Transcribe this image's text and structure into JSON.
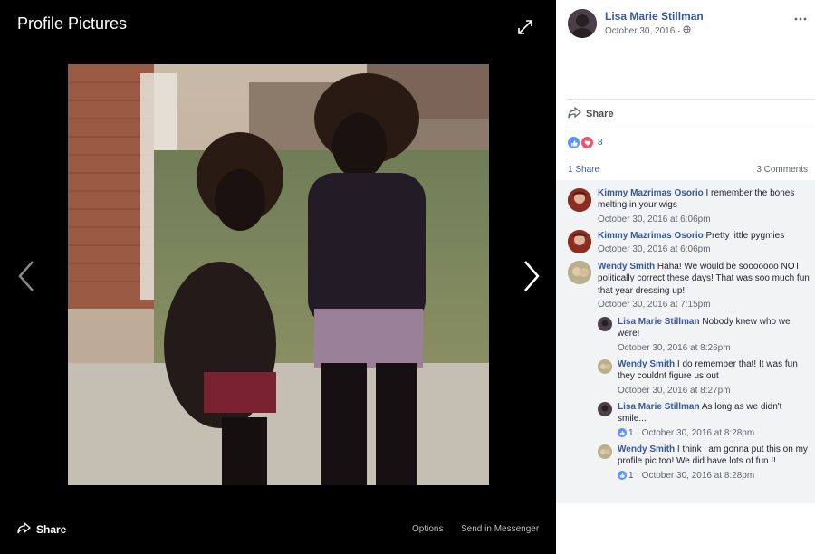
{
  "viewer": {
    "title": "Profile Pictures",
    "share_label": "Share",
    "options_label": "Options",
    "send_label": "Send in Messenger"
  },
  "post": {
    "author": "Lisa Marie Stillman",
    "date": "October 30, 2016 ·",
    "share_label": "Share",
    "reaction_count": "8",
    "shares_label": "1 Share",
    "comments_label": "3 Comments"
  },
  "comments": [
    {
      "name": "Kimmy Mazrimas Osorio",
      "text": " I remember the bones melting in your wigs",
      "time": "October 30, 2016 at 6:06pm"
    },
    {
      "name": "Kimmy Mazrimas Osorio",
      "text": " Pretty little pygmies",
      "time": "October 30, 2016 at 6:06pm"
    },
    {
      "name": "Wendy Smith",
      "text": " Haha! We would be sooooooo NOT politically correct these days! That was soo much fun that year dressing up!!",
      "time": "October 30, 2016 at 7:15pm"
    }
  ],
  "replies": [
    {
      "name": "Lisa Marie Stillman",
      "text": " Nobody knew who we were!",
      "time": "October 30, 2016 at 8:26pm"
    },
    {
      "name": "Wendy Smith",
      "text": " I do remember that! It was fun they couldnt figure us out",
      "time": "October 30, 2016 at 8:27pm"
    },
    {
      "name": "Lisa Marie Stillman",
      "text": " As long as we didn't smile...",
      "likes": "1",
      "time": "· October 30, 2016 at 8:28pm"
    },
    {
      "name": "Wendy Smith",
      "text": " I think i am gonna put this on my profile pic too! We did have lots of fun !!",
      "likes": "1",
      "time": "· October 30, 2016 at 8:28pm"
    }
  ],
  "colors": {
    "link": "#365899",
    "meta": "#616770",
    "comments_bg": "#f2f3f5",
    "viewer_bg": "#000000"
  },
  "icons": [
    "expand-icon",
    "arrow-left-icon",
    "arrow-right-icon",
    "share-icon",
    "globe-icon",
    "more-icon",
    "like-icon",
    "love-icon"
  ]
}
